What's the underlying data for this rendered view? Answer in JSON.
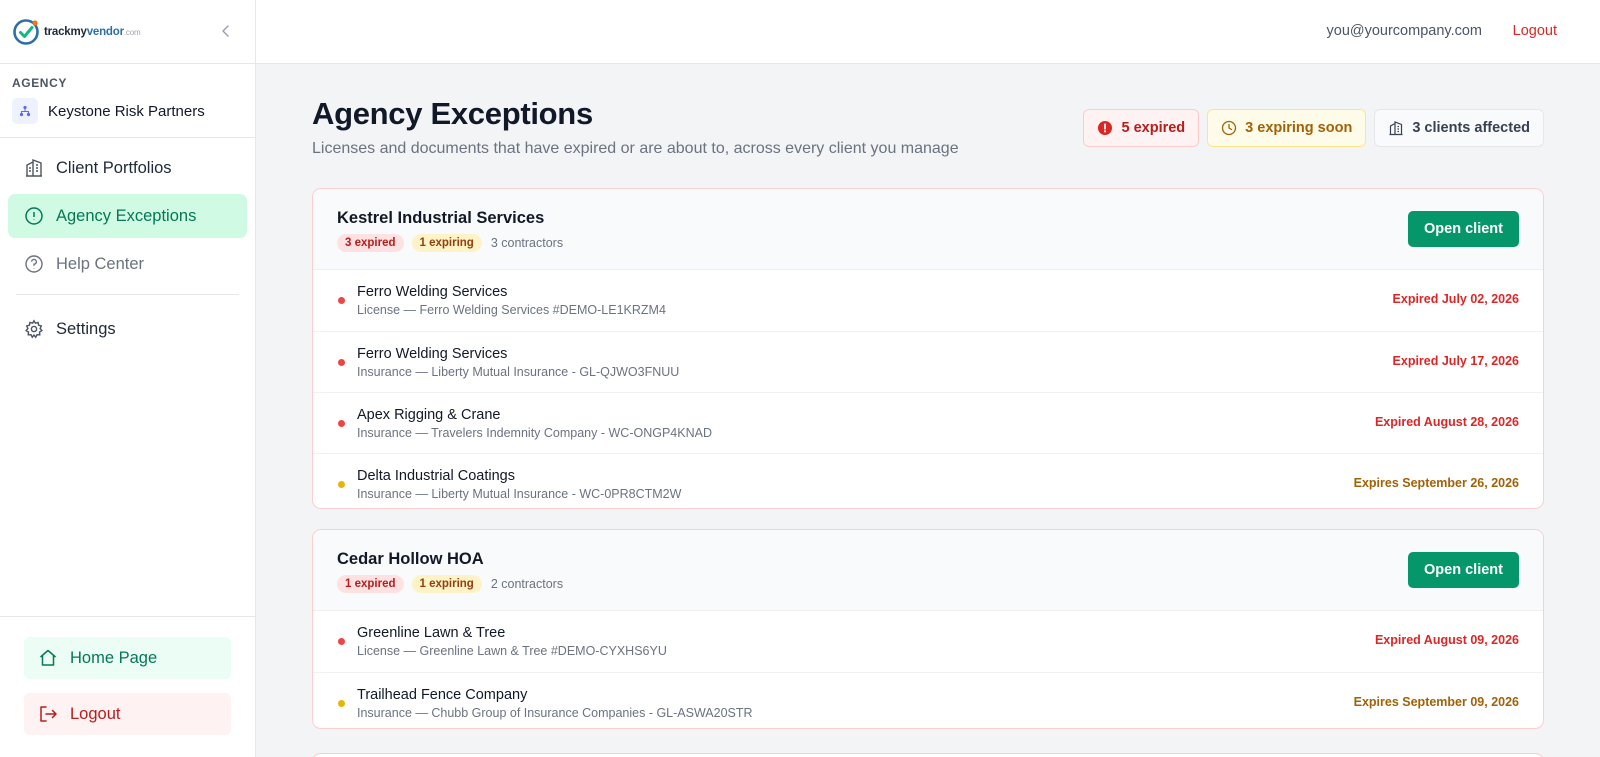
{
  "brand": {
    "name_part1": "trackmy",
    "name_part2": "vendor",
    "suffix": ".com"
  },
  "agency": {
    "caption": "AGENCY",
    "name": "Keystone Risk Partners"
  },
  "nav": {
    "client_portfolios": "Client Portfolios",
    "agency_exceptions": "Agency Exceptions",
    "help_center": "Help Center",
    "settings": "Settings"
  },
  "sidebar_bottom": {
    "home": "Home Page",
    "logout": "Logout"
  },
  "topbar": {
    "user_email": "you@yourcompany.com",
    "logout": "Logout"
  },
  "page": {
    "title": "Agency Exceptions",
    "subtitle": "Licenses and documents that have expired or are about to, across every client you manage"
  },
  "summary": {
    "expired": "5 expired",
    "expiring": "3 expiring soon",
    "clients": "3 clients affected"
  },
  "colors": {
    "accent": "#059669",
    "expired": "#dc2626",
    "expiring": "#a16207"
  },
  "clients": [
    {
      "name": "Kestrel Industrial Services",
      "expired_chip": "3 expired",
      "expiring_chip": "1 expiring",
      "contractors": "3 contractors",
      "open_label": "Open client",
      "items": [
        {
          "name": "Ferro Welding Services",
          "detail": "License — Ferro Welding Services #DEMO-LE1KRZM4",
          "status": "Expired July 02, 2026",
          "state": "expired"
        },
        {
          "name": "Ferro Welding Services",
          "detail": "Insurance — Liberty Mutual Insurance - GL-QJWO3FNUU",
          "status": "Expired July 17, 2026",
          "state": "expired"
        },
        {
          "name": "Apex Rigging & Crane",
          "detail": "Insurance — Travelers Indemnity Company - WC-ONGP4KNAD",
          "status": "Expired August 28, 2026",
          "state": "expired"
        },
        {
          "name": "Delta Industrial Coatings",
          "detail": "Insurance — Liberty Mutual Insurance - WC-0PR8CTM2W",
          "status": "Expires September 26, 2026",
          "state": "expiring"
        }
      ]
    },
    {
      "name": "Cedar Hollow HOA",
      "expired_chip": "1 expired",
      "expiring_chip": "1 expiring",
      "contractors": "2 contractors",
      "open_label": "Open client",
      "items": [
        {
          "name": "Greenline Lawn & Tree",
          "detail": "License — Greenline Lawn & Tree #DEMO-CYXHS6YU",
          "status": "Expired August 09, 2026",
          "state": "expired"
        },
        {
          "name": "Trailhead Fence Company",
          "detail": "Insurance — Chubb Group of Insurance Companies - GL-ASWA20STR",
          "status": "Expires September 09, 2026",
          "state": "expiring"
        }
      ]
    }
  ]
}
